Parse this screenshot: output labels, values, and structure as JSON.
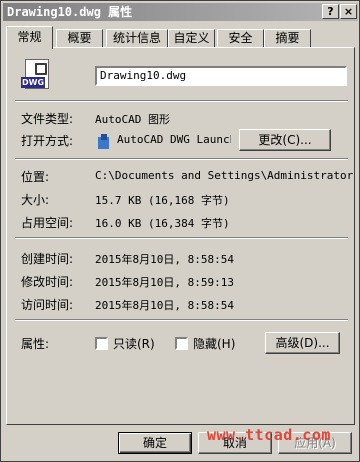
{
  "window": {
    "title": "Drawing10.dwg 属性",
    "help_button": "?",
    "close_button": "×"
  },
  "tabs": [
    {
      "label": "常规",
      "active": true
    },
    {
      "label": "概要"
    },
    {
      "label": "统计信息"
    },
    {
      "label": "自定义"
    },
    {
      "label": "安全"
    },
    {
      "label": "摘要"
    }
  ],
  "file": {
    "icon_text": "DWG",
    "name": "Drawing10.dwg"
  },
  "details": {
    "type_label": "文件类型:",
    "type_value": "AutoCAD 图形",
    "opens_with_label": "打开方式:",
    "opens_with_value": "AutoCAD DWG Launcher",
    "change_button": "更改(C)...",
    "location_label": "位置:",
    "location_value": "C:\\Documents and Settings\\Administrator\\My Documents",
    "size_label": "大小:",
    "size_value": "15.7 KB (16,168 字节)",
    "size_on_disk_label": "占用空间:",
    "size_on_disk_value": "16.0 KB (16,384 字节)",
    "created_label": "创建时间:",
    "created_value": "2015年8月10日, 8:58:54",
    "modified_label": "修改时间:",
    "modified_value": "2015年8月10日, 8:59:13",
    "accessed_label": "访问时间:",
    "accessed_value": "2015年8月10日, 8:58:54"
  },
  "attributes": {
    "label": "属性:",
    "readonly_label": "只读(R)",
    "hidden_label": "隐藏(H)",
    "advanced_button": "高级(D)..."
  },
  "footer": {
    "ok": "确定",
    "cancel": "取消",
    "apply": "应用(A)"
  },
  "watermark": "www.ttcad.com"
}
